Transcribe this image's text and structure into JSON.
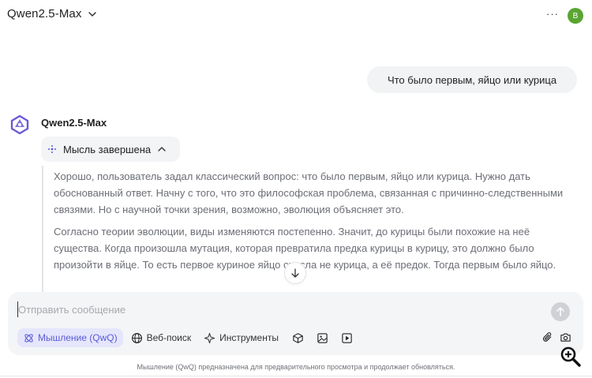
{
  "header": {
    "model_name": "Qwen2.5-Max",
    "more_label": "···",
    "avatar_letter": "B"
  },
  "conversation": {
    "user_message": "Что было первым, яйцо или курица",
    "bot_name": "Qwen2.5-Max",
    "thought_chip_label": "Мысль завершена",
    "reasoning_paragraphs": [
      "Хорошо, пользователь задал классический вопрос: что было первым, яйцо или курица. Нужно дать обоснованный ответ. Начну с того, что это философская проблема, связанная с причинно-следственными связями. Но с научной точки зрения, возможно, эволюция объясняет это.",
      "Согласно теории эволюции, виды изменяются постепенно. Значит, до курицы были похожие на неё существа. Когда произошла мутация, которая превратила предка курицы в курицу, это должно было произойти в яйце. То есть первое куриное яйцо снесла не курица, а её предок. Тогда первым было яйцо."
    ]
  },
  "composer": {
    "placeholder": "Отправить сообщение",
    "value": "",
    "tools": {
      "thinking": "Мышление (QwQ)",
      "web_search": "Веб-поиск",
      "instruments": "Инструменты"
    }
  },
  "footer": {
    "note": "Мышление (QwQ) предназначена для предварительного просмотра и продолжает обновляться."
  },
  "colors": {
    "avatar": "#5aa533",
    "accent": "#5b5bd6",
    "accent_bg": "#e5e6fb",
    "composer_bg": "#f4f5f7",
    "reasoning_text": "#6b6e75"
  }
}
